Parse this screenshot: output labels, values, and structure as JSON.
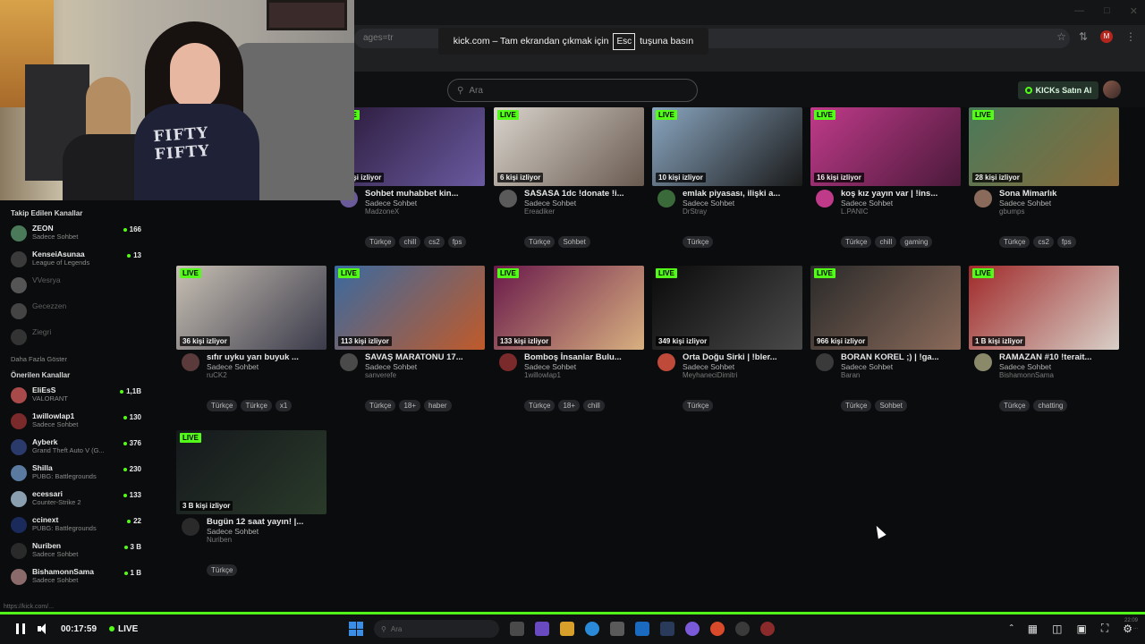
{
  "browser": {
    "address_text": "ages=tr",
    "fullscreen_notice": {
      "before": "kick.com – Tam ekrandan çıkmak için",
      "key": "Esc",
      "after": "tuşuna basın"
    }
  },
  "header": {
    "search_placeholder": "Ara",
    "kicks_button": "KICKs Satın Al"
  },
  "webcam": {
    "hoodie_text": "FIFTY FIFTY"
  },
  "sidebar": {
    "followed_title": "Takip Edilen Kanallar",
    "followed": [
      {
        "name": "ZEON",
        "category": "Sadece Sohbet",
        "count": "166",
        "online": true,
        "color": "#4a7a5a"
      },
      {
        "name": "KenseiAsunaa",
        "category": "League of Legends",
        "count": "13",
        "online": true,
        "color": "#3a3a3a"
      },
      {
        "name": "VVesrya",
        "category": "",
        "count": "",
        "online": false,
        "color": "#555"
      },
      {
        "name": "Gecezzen",
        "category": "",
        "count": "",
        "online": false,
        "color": "#444"
      },
      {
        "name": "Ziegri",
        "category": "",
        "count": "",
        "online": false,
        "color": "#333"
      }
    ],
    "show_more": "Daha Fazla Göster",
    "recommended_title": "Önerilen Kanallar",
    "recommended": [
      {
        "name": "EliEsS",
        "category": "VALORANT",
        "count": "1,1B",
        "color": "#a84a4a"
      },
      {
        "name": "1willowlap1",
        "category": "Sadece Sohbet",
        "count": "130",
        "color": "#7a2a2a"
      },
      {
        "name": "Ayberk",
        "category": "Grand Theft Auto V (G...",
        "count": "376",
        "color": "#2a3a6a"
      },
      {
        "name": "Shilla",
        "category": "PUBG: Battlegrounds",
        "count": "230",
        "color": "#5a7aa0"
      },
      {
        "name": "ecessari",
        "category": "Counter-Strike 2",
        "count": "133",
        "color": "#8aa0b0"
      },
      {
        "name": "ccinext",
        "category": "PUBG: Battlegrounds",
        "count": "22",
        "color": "#1a2a5a"
      },
      {
        "name": "Nuriben",
        "category": "Sadece Sohbet",
        "count": "3 B",
        "color": "#2a2a2a"
      },
      {
        "name": "BishamonnSama",
        "category": "Sadece Sohbet",
        "count": "1 B",
        "color": "#8a6a6a"
      }
    ]
  },
  "streams": [
    {
      "title": "Sohbet muhabbet kin...",
      "category": "Sadece Sohbet",
      "channel": "MadzoneX",
      "viewers": "3 kişi izliyor",
      "tags": [
        "Türkçe",
        "chill",
        "cs2",
        "fps"
      ],
      "thumb": [
        "#2a1a3a",
        "#6a5aa0"
      ],
      "avatar": "#6a5a9a"
    },
    {
      "title": "SASASA 1dc !donate !i...",
      "category": "Sadece Sohbet",
      "channel": "Ereadiker",
      "viewers": "6 kişi izliyor",
      "tags": [
        "Türkçe",
        "Sohbet"
      ],
      "thumb": [
        "#d8d4cc",
        "#6a5a50"
      ],
      "avatar": "#5a5a5a"
    },
    {
      "title": "emlak piyasası, ilişki a...",
      "category": "Sadece Sohbet",
      "channel": "DrStray",
      "viewers": "10 kişi izliyor",
      "tags": [
        "Türkçe"
      ],
      "thumb": [
        "#8aa6c0",
        "#1a1a1a"
      ],
      "avatar": "#3a6a3a"
    },
    {
      "title": "koş kız yayın var | !ins...",
      "category": "Sadece Sohbet",
      "channel": "L.PANIC",
      "viewers": "16 kişi izliyor",
      "tags": [
        "Türkçe",
        "chill",
        "gaming"
      ],
      "thumb": [
        "#c03a8a",
        "#4a1a3a"
      ],
      "avatar": "#c03a8a"
    },
    {
      "title": "Sona Mimarlık",
      "category": "Sadece Sohbet",
      "channel": "gbumps",
      "viewers": "28 kişi izliyor",
      "tags": [
        "Türkçe",
        "cs2",
        "fps"
      ],
      "thumb": [
        "#4a7a5a",
        "#8a6a3a"
      ],
      "avatar": "#8a6a5a"
    },
    {
      "title": "sıfır uyku yarı buyuk ...",
      "category": "Sadece Sohbet",
      "channel": "ruCK2",
      "viewers": "36 kişi izliyor",
      "tags": [
        "Türkçe",
        "Türkçe",
        "x1"
      ],
      "thumb": [
        "#c8c0b4",
        "#3a3a4a"
      ],
      "avatar": "#5a3a3a"
    },
    {
      "title": "SAVAŞ MARATONU 17...",
      "category": "Sadece Sohbet",
      "channel": "sanverefe",
      "viewers": "113 kişi izliyor",
      "tags": [
        "Türkçe",
        "18+",
        "haber"
      ],
      "thumb": [
        "#3a6aa0",
        "#c05a2a"
      ],
      "avatar": "#4a4a4a"
    },
    {
      "title": "Bomboş İnsanlar Bulu...",
      "category": "Sadece Sohbet",
      "channel": "1willowlap1",
      "viewers": "133 kişi izliyor",
      "tags": [
        "Türkçe",
        "18+",
        "chill"
      ],
      "thumb": [
        "#6a1a4a",
        "#d8b080"
      ],
      "avatar": "#7a2a2a"
    },
    {
      "title": "Orta Doğu Sirki | !bler...",
      "category": "Sadece Sohbet",
      "channel": "MeyhaneciDimitri",
      "viewers": "349 kişi izliyor",
      "tags": [
        "Türkçe"
      ],
      "thumb": [
        "#0a0a0a",
        "#4a4a4a"
      ],
      "avatar": "#c04a3a"
    },
    {
      "title": "BORAN KOREL ;) | !ga...",
      "category": "Sadece Sohbet",
      "channel": "Baran",
      "viewers": "966 kişi izliyor",
      "tags": [
        "Türkçe",
        "Sohbet"
      ],
      "thumb": [
        "#2a2a2a",
        "#8a6a5a"
      ],
      "avatar": "#3a3a3a"
    },
    {
      "title": "RAMAZAN #10 !terait...",
      "category": "Sadece Sohbet",
      "channel": "BishamonnSama",
      "viewers": "1 B kişi izliyor",
      "tags": [
        "Türkçe",
        "chatting"
      ],
      "thumb": [
        "#a02a2a",
        "#d8d0c8"
      ],
      "avatar": "#8a8a6a"
    },
    {
      "title": "Bugün 12 saat yayın! |...",
      "category": "Sadece Sohbet",
      "channel": "Nuriben",
      "viewers": "3 B kişi izliyor",
      "tags": [
        "Türkçe"
      ],
      "thumb": [
        "#15181c",
        "#2a3a2a"
      ],
      "avatar": "#2a2a2a"
    }
  ],
  "player": {
    "time": "00:17:59",
    "live_label": "LIVE",
    "status_url": "https://kick.com/..."
  },
  "taskbar": {
    "search_placeholder": "Ara",
    "clock_time": "22:09",
    "clock_date": "..."
  },
  "colors": {
    "accent": "#53fc18",
    "background": "#0b0c0d"
  }
}
